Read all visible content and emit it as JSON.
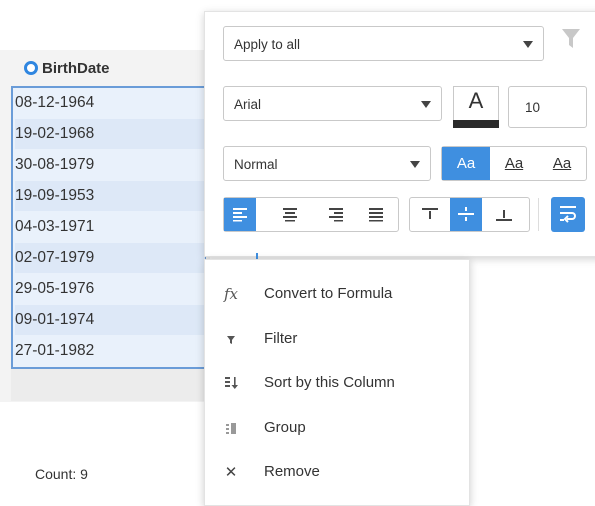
{
  "column": {
    "header": "BirthDate",
    "cells": [
      "08-12-1964",
      "19-02-1968",
      "30-08-1979",
      "19-09-1953",
      "04-03-1971",
      "02-07-1979",
      "29-05-1976",
      "09-01-1974",
      "27-01-1982"
    ]
  },
  "footer": {
    "count_label": "Count: 9"
  },
  "format_panel": {
    "apply_select": "Apply to all",
    "font_family": "Arial",
    "font_color_glyph": "A",
    "font_size": "10",
    "font_style": "Normal",
    "case_buttons": [
      "Aa",
      "Aa",
      "Aa"
    ],
    "colors": {
      "accent": "#3f8fe0",
      "font_color": "#2a2a2a"
    }
  },
  "context_menu": {
    "items": [
      {
        "label": "Convert to Formula",
        "icon": "fx-icon",
        "glyph": "fx"
      },
      {
        "label": "Filter",
        "icon": "filter-icon"
      },
      {
        "label": "Sort by this Column",
        "icon": "sort-icon"
      },
      {
        "label": "Group",
        "icon": "group-icon"
      },
      {
        "label": "Remove",
        "icon": "remove-icon",
        "glyph": "✕"
      }
    ]
  }
}
